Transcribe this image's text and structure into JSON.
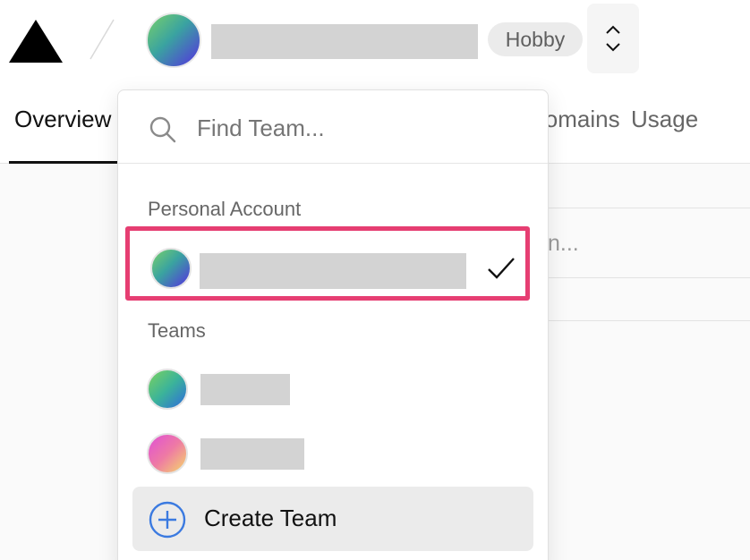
{
  "header": {
    "plan_badge": "Hobby",
    "tabs": [
      {
        "label": "Overview"
      },
      {
        "label": "Domains"
      },
      {
        "label": "Usage"
      }
    ]
  },
  "background": {
    "fragment_text": "n..."
  },
  "team_switcher": {
    "search": {
      "placeholder": "Find Team...",
      "value": ""
    },
    "personal_section_label": "Personal Account",
    "teams_section_label": "Teams",
    "create_label": "Create Team"
  },
  "colors": {
    "highlight_border": "#e63e72",
    "plus_icon": "#3b7ae0"
  }
}
